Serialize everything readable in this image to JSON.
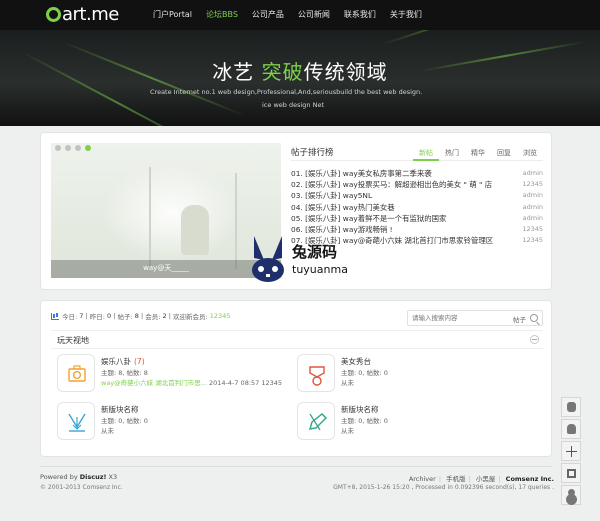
{
  "header": {
    "logo_text": "art.me",
    "nav": [
      {
        "label": "门户Portal",
        "active": false
      },
      {
        "label": "论坛BBS",
        "active": true
      },
      {
        "label": "公司产品",
        "active": false
      },
      {
        "label": "公司新闻",
        "active": false
      },
      {
        "label": "联系我们",
        "active": false
      },
      {
        "label": "关于我们",
        "active": false
      }
    ]
  },
  "hero": {
    "title_a": "冰艺 ",
    "title_b": "突破",
    "title_c": "传统领域",
    "subtitle_1": "Create Internet no.1 web design,Professional,And,seriousbuild the best web design.",
    "subtitle_2": "ice web design Net"
  },
  "slider": {
    "caption": "way@天_____",
    "dots": 4,
    "active_dot": 4
  },
  "ranking": {
    "title": "帖子排行榜",
    "tabs": [
      "新帖",
      "热门",
      "精华",
      "回复",
      "浏览"
    ],
    "active_tab": 0,
    "items": [
      {
        "text": "01. [娱乐八卦] way美女私房事第二季来袭",
        "meta": "admin"
      },
      {
        "text": "02. [娱乐八卦] way投票买马：解超逊相出色的美女 \" 萌 \" 店",
        "meta": "12345"
      },
      {
        "text": "03. [娱乐八卦] way5NL",
        "meta": "admin"
      },
      {
        "text": "04. [娱乐八卦] way热门美女巷",
        "meta": "admin"
      },
      {
        "text": "05. [娱乐八卦] way着鲜不是一个有监狱的国家",
        "meta": "admin"
      },
      {
        "text": "06. [娱乐八卦] way游戏畅销 !",
        "meta": "12345"
      },
      {
        "text": "07. [娱乐八卦] way@奇葩小六妹 湖北首打门市思家铃管理区",
        "meta": "12345"
      }
    ]
  },
  "watermark": {
    "line1": "兔源码",
    "line2": "tuyuanma"
  },
  "stats": {
    "today_label": "今日:",
    "today": "7",
    "yesterday_label": "昨日:",
    "yesterday": "0",
    "posts_label": "帖子:",
    "posts": "8",
    "members_label": "会员:",
    "members": "2",
    "newest_label": "欢迎新会员:",
    "newest": "12345"
  },
  "search": {
    "placeholder": "请输入搜索内容",
    "type": "帖子"
  },
  "category": {
    "name": "玩天视地"
  },
  "forums": [
    {
      "name": "娱乐八卦",
      "today": "(7)",
      "stats": "主题: 8, 帖数: 8",
      "last_link": "way@奇葩小六妹 湖北首判门市思...",
      "last_time": " 2014-4-7 08:57 ",
      "last_user": "12345",
      "icon": "camera-icon"
    },
    {
      "name": "美女秀台",
      "today": "",
      "stats": "主题: 0, 帖数: 0",
      "last_link": "",
      "last_time": "从未",
      "last_user": "",
      "icon": "badge-icon"
    },
    {
      "name": "新版块名称",
      "today": "",
      "stats": "主题: 0, 帖数: 0",
      "last_link": "",
      "last_time": "从未",
      "last_user": "",
      "icon": "download-icon"
    },
    {
      "name": "新版块名称",
      "today": "",
      "stats": "主题: 0, 帖数: 0",
      "last_link": "",
      "last_time": "从未",
      "last_user": "",
      "icon": "pencil-icon"
    }
  ],
  "footer": {
    "powered_prefix": "Powered by ",
    "powered_name": "Discuz!",
    "powered_ver": " X3",
    "copyright": "© 2001-2013 Comsenz Inc.",
    "links": [
      "Archiver",
      "手机版",
      "小黑屋"
    ],
    "company": "Comsenz Inc.",
    "debug": "GMT+8, 2015-1-26 15:20 , Processed in 0.092396 second(s), 17 queries ."
  },
  "floatbar": {
    "buttons": [
      "smile-icon",
      "penguin-icon",
      "plus-icon",
      "qrcode-icon",
      "user-icon"
    ]
  },
  "colors": {
    "accent": "#7dd14a",
    "topbar": "#111111"
  }
}
